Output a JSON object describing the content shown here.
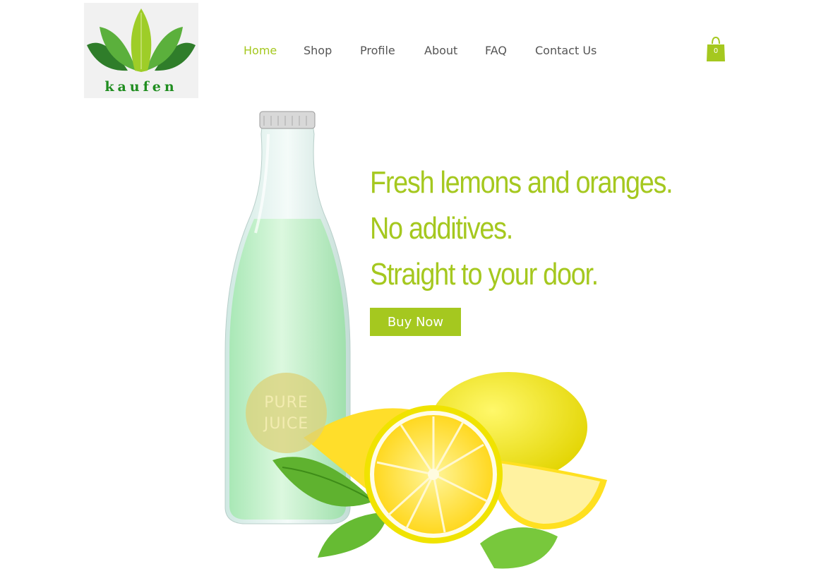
{
  "logo": {
    "text": "kaufen"
  },
  "nav": {
    "items": [
      {
        "label": "Home",
        "active": true
      },
      {
        "label": "Shop"
      },
      {
        "label": "Profile"
      },
      {
        "label": "About"
      },
      {
        "label": "FAQ"
      },
      {
        "label": "Contact Us"
      }
    ]
  },
  "cart": {
    "count": "0",
    "icon": "shopping-bag-icon"
  },
  "hero": {
    "headline": [
      "Fresh lemons and oranges.",
      "No additives.",
      "Straight to your door."
    ],
    "button_label": "Buy Now",
    "badge": [
      "PURE",
      "JUICE"
    ]
  },
  "colors": {
    "accent": "#a5c81f",
    "nav_text": "#555555",
    "logo_text": "#1f8d1f"
  }
}
